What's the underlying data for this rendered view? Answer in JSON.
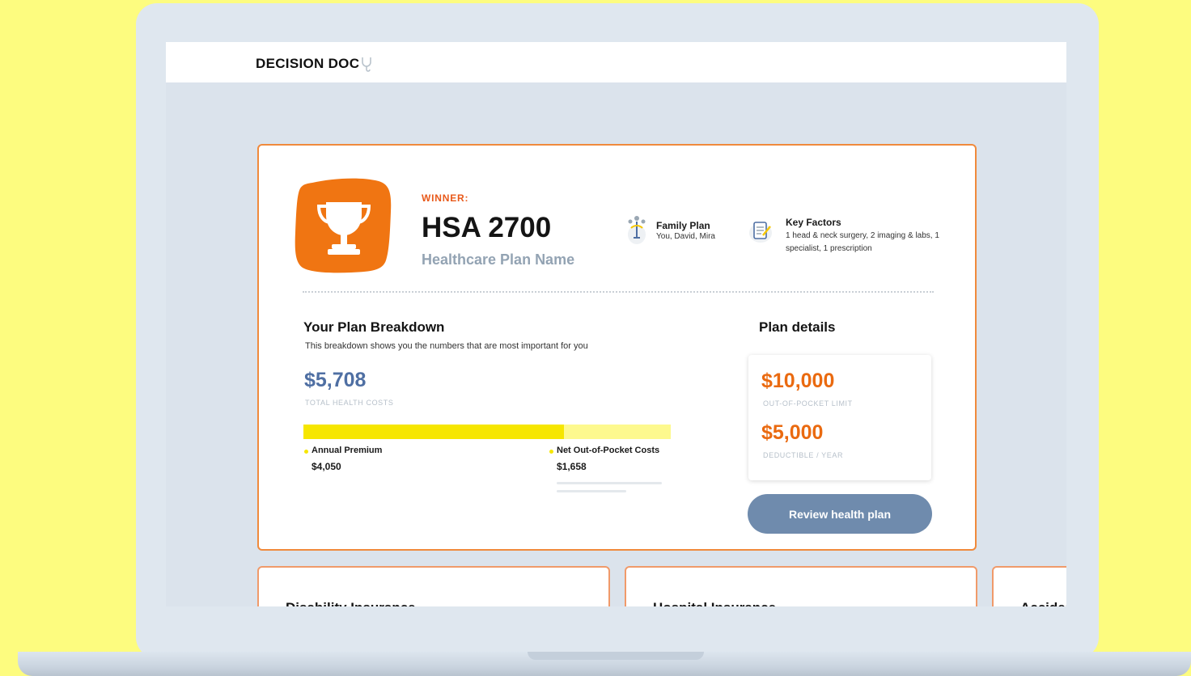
{
  "app": {
    "logo": "DECISION DOC"
  },
  "winner_card": {
    "winner_label": "WINNER:",
    "plan_name": "HSA 2700",
    "plan_subtitle": "Healthcare Plan Name",
    "family": {
      "title": "Family Plan",
      "members": "You, David, Mira"
    },
    "key_factors": {
      "title": "Key Factors",
      "description": "1 head & neck surgery, 2 imaging & labs, 1 specialist, 1 prescription"
    },
    "breakdown": {
      "title": "Your Plan Breakdown",
      "subtitle": "This breakdown shows you the numbers that are most important for you",
      "total_value": "$5,708",
      "total_label": "TOTAL HEALTH COSTS",
      "premium_fraction": 0.709,
      "premium": {
        "label": "Annual Premium",
        "value": "$4,050"
      },
      "net_oop": {
        "label": "Net Out-of-Pocket Costs",
        "value": "$1,658"
      }
    },
    "plan_details": {
      "title": "Plan details",
      "oop_limit_value": "$10,000",
      "oop_limit_label": "OUT-OF-POCKET LIMIT",
      "deductible_value": "$5,000",
      "deductible_label": "DEDUCTIBLE / YEAR"
    },
    "review_button": "Review health plan"
  },
  "lower_cards": [
    {
      "title": "Disability Insurance"
    },
    {
      "title": "Hospital Insurance"
    },
    {
      "title": "Accident Insurance"
    }
  ],
  "colors": {
    "accent_orange": "#ea6a10",
    "winner_red": "#e8591a",
    "total_blue": "#4f6fa3",
    "bar_yellow": "#f6e600",
    "bar_light": "#fdf98e",
    "button_blue": "#6f8bad",
    "background_yellow": "#fdfc7f"
  },
  "icons": [
    "stethoscope-icon",
    "trophy-icon",
    "family-icon",
    "checklist-icon"
  ]
}
